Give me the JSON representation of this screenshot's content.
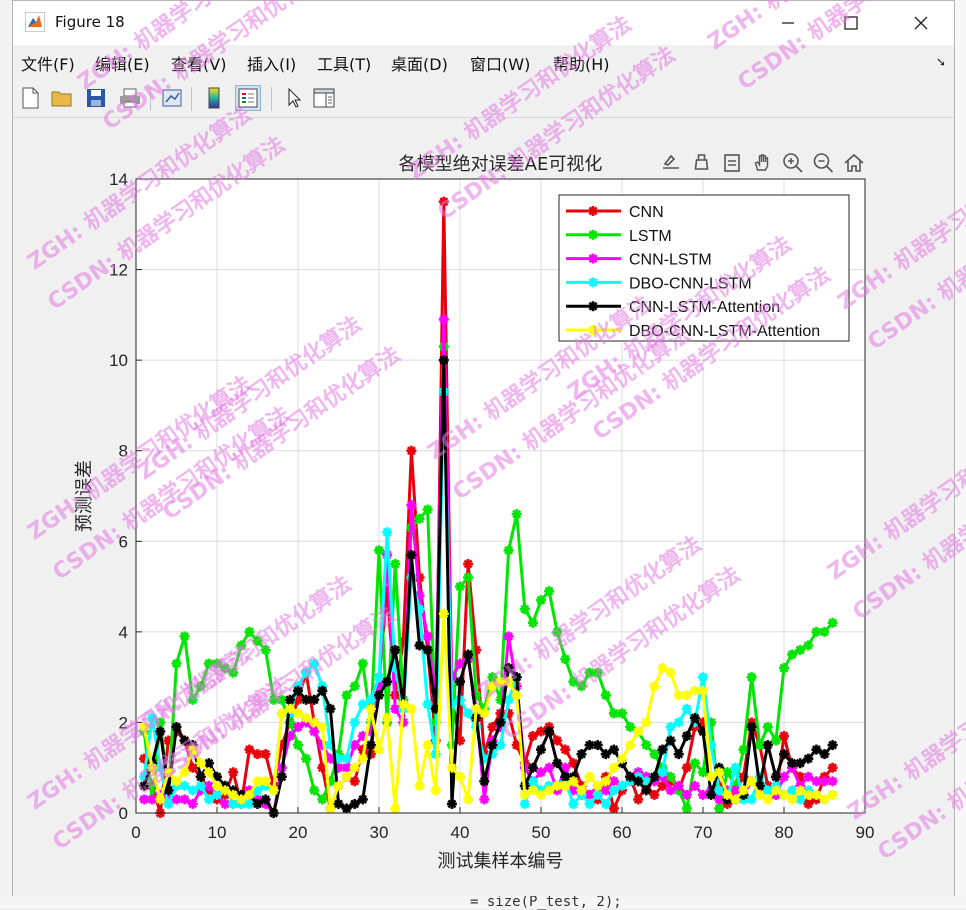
{
  "window": {
    "title": "Figure 18"
  },
  "menu": [
    "文件(F)",
    "编辑(E)",
    "查看(V)",
    "插入(I)",
    "工具(T)",
    "桌面(D)",
    "窗口(W)",
    "帮助(H)"
  ],
  "toolbar": [
    "new-figure",
    "open-file",
    "save",
    "print",
    "link-plot",
    "colorbar",
    "legend",
    "pointer",
    "property-inspector"
  ],
  "axes_toolbar": [
    "export",
    "brush",
    "data-tips",
    "pan",
    "zoom-in",
    "zoom-out",
    "home"
  ],
  "background_code": "= size(P_test, 2);",
  "watermark": [
    "ZGH: 机器学习和优化算法",
    "CSDN: 机器学习和优化算法"
  ],
  "colors": {
    "CNN": "#e8000b",
    "LSTM": "#00e600",
    "CNN-LSTM": "#ff00ff",
    "DBO-CNN-LSTM": "#00ffff",
    "CNN-LSTM-Attention": "#000000",
    "DBO-CNN-LSTM-Attention": "#ffff00"
  },
  "chart_data": {
    "type": "line",
    "title": "各模型绝对误差AE可视化",
    "xlabel": "测试集样本编号",
    "ylabel": "预测误差",
    "xlim": [
      0,
      90
    ],
    "ylim": [
      0,
      14
    ],
    "xticks": [
      0,
      10,
      20,
      30,
      40,
      50,
      60,
      70,
      80,
      90
    ],
    "yticks": [
      0,
      2,
      4,
      6,
      8,
      10,
      12,
      14
    ],
    "grid": true,
    "legend_position": "top-right",
    "x": [
      1,
      2,
      3,
      4,
      5,
      6,
      7,
      8,
      9,
      10,
      11,
      12,
      13,
      14,
      15,
      16,
      17,
      18,
      19,
      20,
      21,
      22,
      23,
      24,
      25,
      26,
      27,
      28,
      29,
      30,
      31,
      32,
      33,
      34,
      35,
      36,
      37,
      38,
      39,
      40,
      41,
      42,
      43,
      44,
      45,
      46,
      47,
      48,
      49,
      50,
      51,
      52,
      53,
      54,
      55,
      56,
      57,
      58,
      59,
      60,
      61,
      62,
      63,
      64,
      65,
      66,
      67,
      68,
      69,
      70,
      71,
      72,
      73,
      74,
      75,
      76,
      77,
      78,
      79,
      80,
      81,
      82,
      83,
      84,
      85,
      86
    ],
    "series": [
      {
        "name": "CNN",
        "values": [
          1.2,
          0.6,
          0.0,
          1.6,
          1.8,
          1.6,
          1.0,
          0.8,
          0.5,
          0.3,
          0.4,
          0.9,
          0.2,
          1.4,
          1.3,
          1.3,
          0.6,
          1.5,
          2.0,
          2.5,
          3.1,
          2.0,
          1.0,
          0.1,
          0.6,
          0.8,
          0.7,
          1.4,
          1.3,
          3.0,
          4.9,
          2.6,
          3.8,
          8.0,
          5.2,
          3.6,
          1.6,
          13.5,
          2.5,
          1.6,
          5.5,
          3.6,
          1.3,
          1.9,
          2.2,
          2.2,
          1.5,
          1.1,
          1.7,
          1.8,
          1.9,
          1.6,
          1.4,
          1.1,
          0.6,
          0.4,
          0.3,
          0.8,
          0.1,
          0.5,
          0.8,
          0.3,
          0.6,
          0.4,
          0.6,
          0.7,
          0.5,
          1.0,
          1.9,
          2.0,
          1.5,
          0.6,
          0.2,
          0.5,
          0.8,
          2.0,
          1.5,
          0.6,
          0.4,
          1.7,
          1.0,
          0.8,
          0.2,
          0.3,
          0.8,
          1.0
        ]
      },
      {
        "name": "LSTM",
        "values": [
          1.8,
          0.3,
          2.0,
          0.4,
          3.3,
          3.9,
          2.5,
          2.8,
          3.3,
          3.3,
          3.2,
          3.1,
          3.7,
          4.0,
          3.8,
          3.6,
          2.5,
          2.5,
          2.0,
          1.5,
          1.2,
          0.5,
          0.3,
          0.7,
          1.3,
          2.6,
          2.8,
          3.3,
          2.0,
          5.8,
          2.0,
          5.5,
          2.5,
          6.3,
          6.5,
          6.7,
          2.0,
          10.3,
          1.5,
          5.0,
          5.2,
          2.6,
          2.3,
          3.0,
          2.5,
          5.8,
          6.6,
          4.5,
          4.2,
          4.7,
          4.9,
          4.0,
          3.4,
          2.9,
          2.8,
          3.1,
          3.1,
          2.6,
          2.2,
          2.2,
          1.9,
          1.8,
          1.5,
          1.3,
          1.0,
          0.8,
          0.5,
          0.1,
          1.1,
          0.9,
          2.0,
          0.1,
          0.9,
          0.6,
          1.4,
          3.0,
          1.5,
          1.9,
          1.6,
          3.2,
          3.5,
          3.6,
          3.7,
          4.0,
          4.0,
          4.2
        ]
      },
      {
        "name": "CNN-LSTM",
        "values": [
          0.3,
          0.3,
          0.4,
          0.3,
          0.3,
          0.3,
          0.2,
          0.5,
          0.6,
          0.4,
          0.2,
          0.2,
          0.3,
          0.5,
          0.3,
          0.2,
          0.0,
          1.0,
          1.7,
          1.9,
          2.0,
          1.8,
          1.5,
          1.2,
          1.0,
          1.0,
          1.5,
          1.7,
          1.8,
          2.8,
          5.7,
          2.3,
          2.0,
          6.8,
          4.8,
          3.9,
          2.6,
          10.9,
          3.0,
          3.3,
          3.4,
          2.3,
          0.3,
          1.6,
          1.9,
          3.9,
          2.8,
          1.0,
          0.7,
          0.9,
          1.0,
          0.5,
          1.0,
          0.5,
          0.4,
          0.4,
          0.6,
          0.5,
          0.7,
          0.6,
          0.7,
          0.9,
          0.8,
          0.7,
          0.8,
          0.5,
          0.6,
          0.4,
          0.6,
          0.4,
          0.5,
          0.3,
          0.5,
          0.5,
          0.4,
          0.7,
          0.5,
          0.5,
          0.4,
          0.8,
          1.0,
          0.6,
          0.8,
          0.7,
          0.7,
          0.7
        ]
      },
      {
        "name": "DBO-CNN-LSTM",
        "values": [
          0.8,
          2.1,
          1.0,
          0.2,
          0.6,
          0.6,
          0.5,
          0.6,
          0.3,
          0.4,
          0.6,
          0.2,
          0.2,
          0.2,
          0.5,
          0.6,
          0.5,
          2.2,
          2.2,
          2.8,
          3.1,
          3.3,
          2.8,
          1.5,
          1.2,
          1.2,
          2.0,
          2.4,
          2.5,
          3.0,
          6.2,
          3.2,
          2.3,
          5.2,
          4.5,
          2.4,
          1.3,
          9.3,
          2.4,
          2.5,
          2.2,
          1.9,
          1.2,
          1.3,
          1.5,
          2.5,
          3.0,
          0.2,
          0.7,
          0.5,
          0.6,
          0.6,
          0.7,
          0.2,
          0.4,
          0.2,
          0.4,
          0.2,
          0.5,
          0.6,
          0.7,
          0.8,
          0.7,
          0.8,
          0.9,
          1.9,
          2.0,
          2.3,
          2.0,
          3.0,
          1.5,
          0.5,
          0.3,
          1.0,
          0.3,
          0.3,
          0.8,
          0.5,
          0.6,
          0.4,
          0.5,
          0.3,
          0.5,
          0.4,
          0.3,
          0.4
        ]
      },
      {
        "name": "CNN-LSTM-Attention",
        "values": [
          0.6,
          1.1,
          1.8,
          0.5,
          1.9,
          1.6,
          1.5,
          0.8,
          1.1,
          0.8,
          0.6,
          0.5,
          0.4,
          0.4,
          0.2,
          0.3,
          0.0,
          0.8,
          2.5,
          2.7,
          2.5,
          2.5,
          2.7,
          2.3,
          0.2,
          0.1,
          0.2,
          0.3,
          1.5,
          2.6,
          2.9,
          3.6,
          2.4,
          5.7,
          3.7,
          3.6,
          2.3,
          10.0,
          0.2,
          2.9,
          3.5,
          2.1,
          0.7,
          1.5,
          2.0,
          3.2,
          3.0,
          0.6,
          1.0,
          1.4,
          1.8,
          1.1,
          0.8,
          0.8,
          1.3,
          1.5,
          1.5,
          1.3,
          1.4,
          1.1,
          0.8,
          0.7,
          0.5,
          0.8,
          1.4,
          1.6,
          1.3,
          1.7,
          2.1,
          1.8,
          0.4,
          1.0,
          0.3,
          0.3,
          0.4,
          1.9,
          0.6,
          1.5,
          0.8,
          1.3,
          1.1,
          1.1,
          1.2,
          1.4,
          1.3,
          1.5
        ]
      },
      {
        "name": "DBO-CNN-LSTM-Attention",
        "values": [
          1.9,
          1.0,
          0.3,
          0.9,
          0.7,
          0.9,
          1.4,
          1.1,
          0.9,
          0.6,
          0.5,
          0.4,
          0.3,
          0.4,
          0.7,
          0.7,
          0.5,
          2.2,
          2.3,
          2.2,
          2.1,
          2.0,
          1.9,
          0.1,
          0.6,
          0.8,
          1.0,
          1.2,
          2.3,
          1.4,
          2.1,
          0.1,
          2.4,
          2.3,
          0.6,
          1.5,
          0.5,
          4.4,
          1.0,
          0.8,
          0.3,
          2.3,
          2.2,
          2.8,
          2.9,
          2.9,
          2.6,
          0.4,
          0.5,
          0.4,
          0.5,
          0.6,
          0.6,
          0.7,
          0.5,
          0.8,
          0.6,
          0.7,
          1.0,
          1.2,
          1.5,
          1.8,
          2.0,
          2.8,
          3.2,
          3.1,
          2.6,
          2.6,
          2.7,
          2.7,
          0.8,
          0.9,
          0.4,
          0.3,
          0.5,
          0.7,
          0.4,
          0.3,
          0.5,
          0.4,
          0.3,
          0.5,
          0.4,
          0.4,
          0.3,
          0.4
        ]
      }
    ]
  }
}
